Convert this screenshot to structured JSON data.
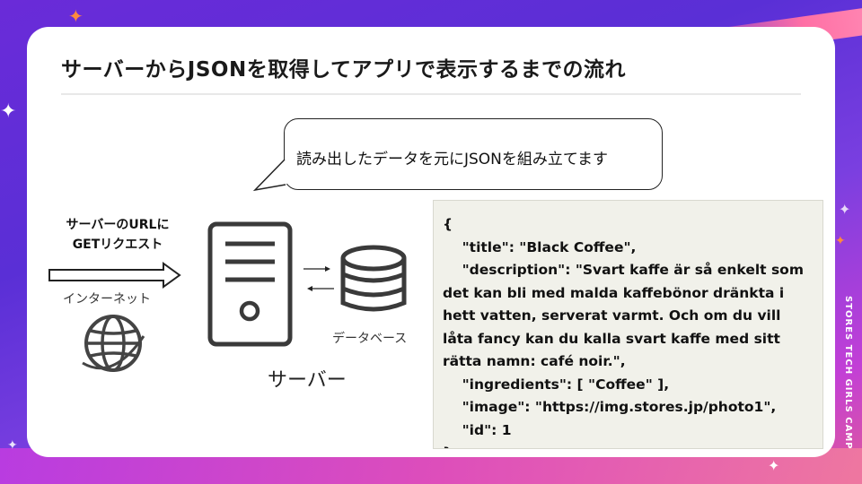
{
  "slide": {
    "title": "サーバーからJSONを取得してアプリで表示するまでの流れ",
    "bubble_text": "読み出したデータを元にJSONを組み立てます",
    "request_label_line1": "サーバーのURLに",
    "request_label_line2": "GETリクエスト",
    "internet_label": "インターネット",
    "server_label": "サーバー",
    "database_label": "データベース",
    "brand_text": "STORES TECH GIRLS CAMP",
    "code_json": "{\n    \"title\": \"Black Coffee\",\n    \"description\": \"Svart kaffe är så enkelt som det kan bli med malda kaffebönor dränkta i hett vatten, serverat varmt. Och om du vill låta fancy kan du kalla svart kaffe med sitt rätta namn: café noir.\",\n    \"ingredients\": [ \"Coffee\" ],\n    \"image\": \"https://img.stores.jp/photo1\",\n    \"id\": 1\n}"
  },
  "icons": [
    "arrow-right-icon",
    "globe-icon",
    "server-icon",
    "database-icon",
    "sync-arrows-icon",
    "sparkle-icon"
  ],
  "colors": {
    "accent_purple": "#6a2bd8",
    "accent_pink": "#e24fb8",
    "sparkle_orange": "#ff8a3d",
    "code_bg": "#f1f1ea"
  }
}
